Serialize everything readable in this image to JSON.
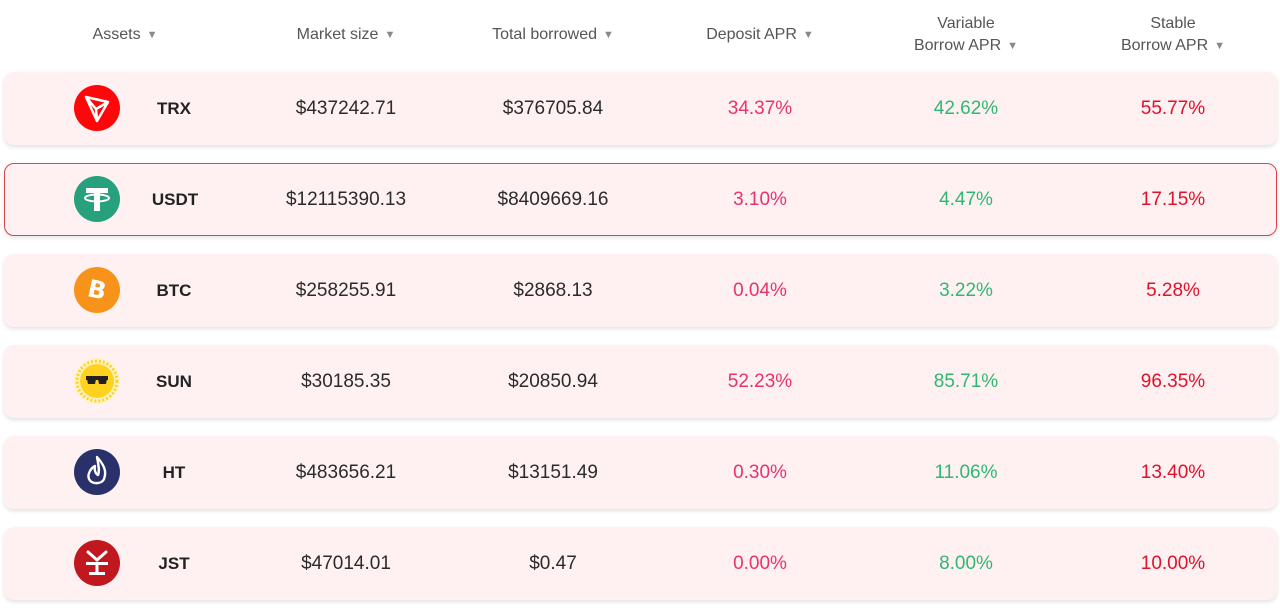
{
  "header": {
    "assets": "Assets",
    "market_size": "Market size",
    "total_borrowed": "Total borrowed",
    "deposit_apr": "Deposit APR",
    "variable_line1": "Variable",
    "variable_line2": "Borrow APR",
    "stable_line1": "Stable",
    "stable_line2": "Borrow APR",
    "sort_arrow": "▼"
  },
  "colors": {
    "row_bg": "#fff1f2",
    "selected_border": "#e0424a",
    "deposit": "#e6336e",
    "variable": "#2eb872",
    "stable": "#e0112b"
  },
  "rows": [
    {
      "symbol": "TRX",
      "icon": "trx-icon",
      "market_size": "$437242.71",
      "total_borrowed": "$376705.84",
      "deposit_apr": "34.37%",
      "variable_apr": "42.62%",
      "stable_apr": "55.77%"
    },
    {
      "symbol": "USDT",
      "icon": "usdt-icon",
      "market_size": "$12115390.13",
      "total_borrowed": "$8409669.16",
      "deposit_apr": "3.10%",
      "variable_apr": "4.47%",
      "stable_apr": "17.15%"
    },
    {
      "symbol": "BTC",
      "icon": "btc-icon",
      "market_size": "$258255.91",
      "total_borrowed": "$2868.13",
      "deposit_apr": "0.04%",
      "variable_apr": "3.22%",
      "stable_apr": "5.28%"
    },
    {
      "symbol": "SUN",
      "icon": "sun-icon",
      "market_size": "$30185.35",
      "total_borrowed": "$20850.94",
      "deposit_apr": "52.23%",
      "variable_apr": "85.71%",
      "stable_apr": "96.35%"
    },
    {
      "symbol": "HT",
      "icon": "ht-icon",
      "market_size": "$483656.21",
      "total_borrowed": "$13151.49",
      "deposit_apr": "0.30%",
      "variable_apr": "11.06%",
      "stable_apr": "13.40%"
    },
    {
      "symbol": "JST",
      "icon": "jst-icon",
      "market_size": "$47014.01",
      "total_borrowed": "$0.47",
      "deposit_apr": "0.00%",
      "variable_apr": "8.00%",
      "stable_apr": "10.00%"
    }
  ]
}
